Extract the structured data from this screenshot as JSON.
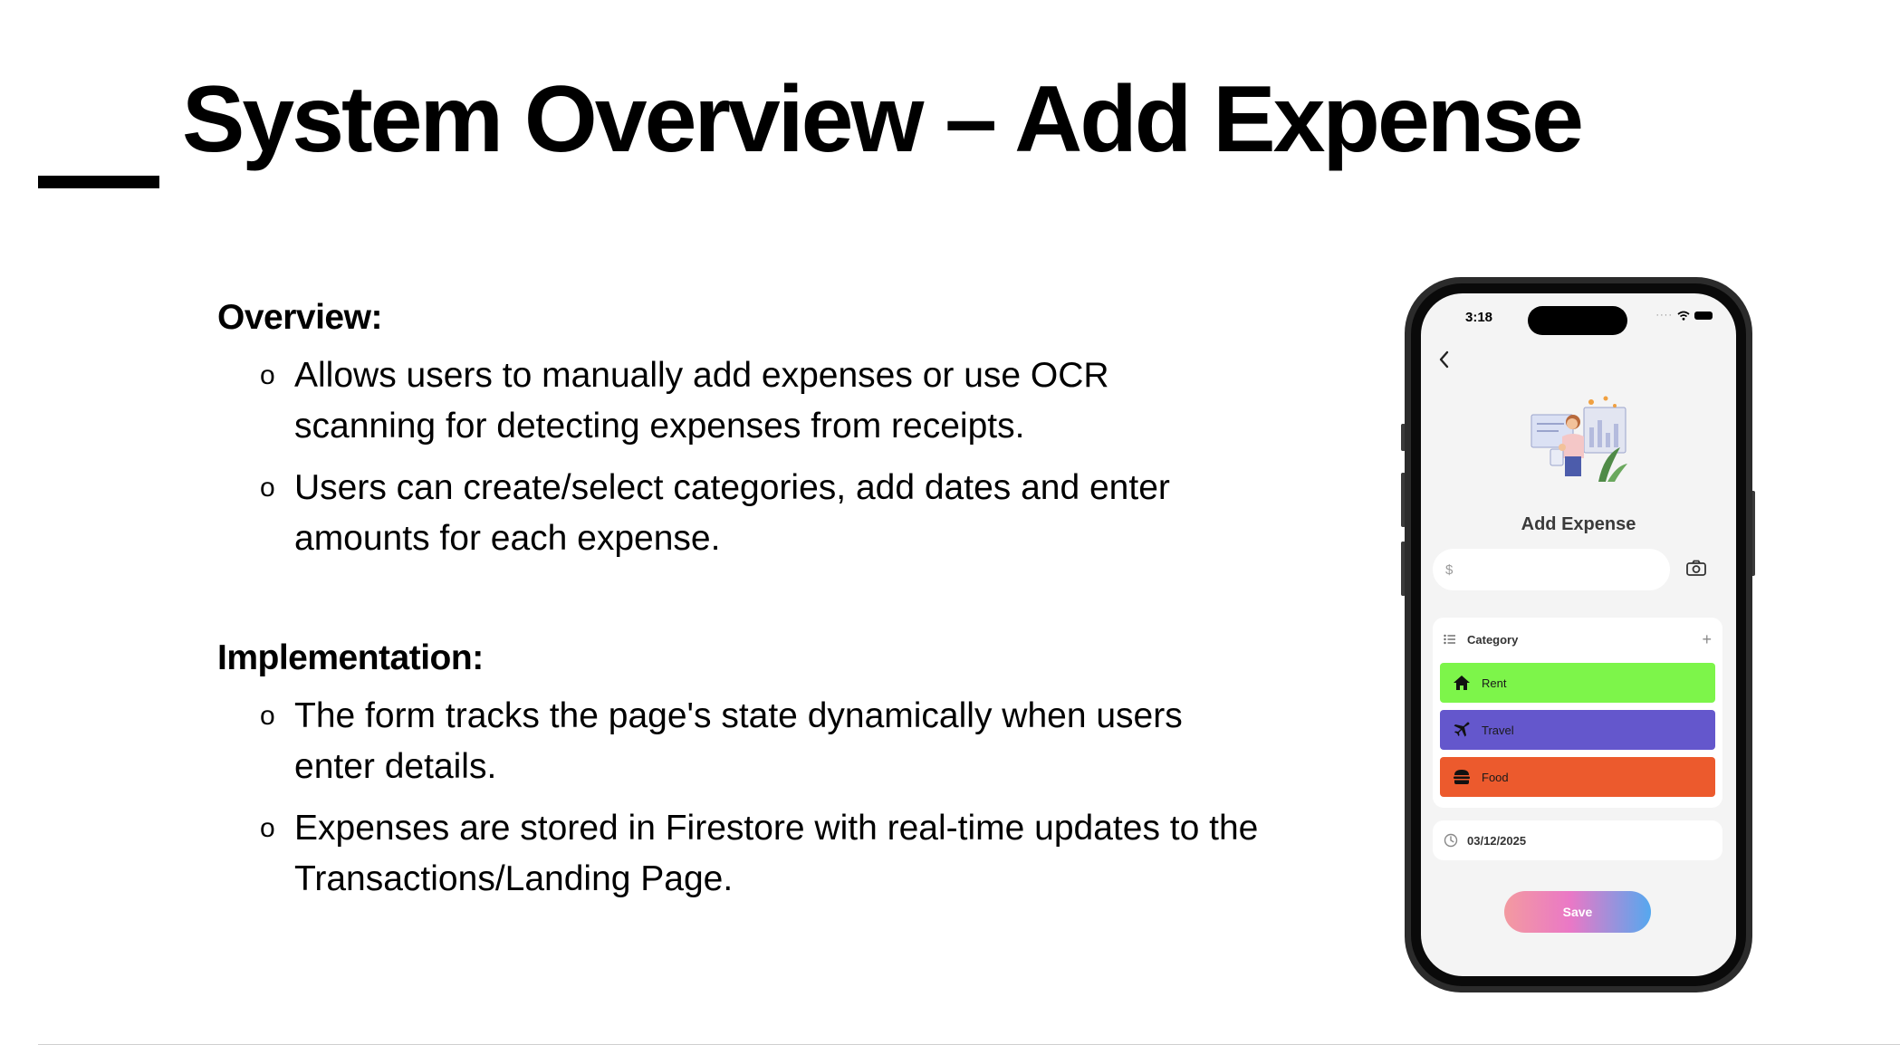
{
  "slide": {
    "title": "System Overview – Add Expense",
    "sections": [
      {
        "heading": "Overview:",
        "bullets": [
          "Allows users to manually add expenses or use OCR scanning for detecting expenses from receipts.",
          "Users can create/select categories, add dates and enter amounts for each expense."
        ]
      },
      {
        "heading": "Implementation:",
        "bullets": [
          "The form tracks the page's state dynamically when users enter details.",
          "Expenses are stored in Firestore with real-time updates to the Transactions/Landing Page."
        ]
      }
    ],
    "bullet_marker": "o"
  },
  "phone": {
    "status_time": "3:18",
    "screen_title": "Add Expense",
    "amount_placeholder": "$",
    "category_label": "Category",
    "categories": [
      {
        "name": "Rent",
        "color": "#7df54a",
        "icon": "house-icon"
      },
      {
        "name": "Travel",
        "color": "#6457cc",
        "icon": "airplane-icon"
      },
      {
        "name": "Food",
        "color": "#ec5a2d",
        "icon": "burger-icon"
      }
    ],
    "date": "03/12/2025",
    "save_label": "Save"
  }
}
